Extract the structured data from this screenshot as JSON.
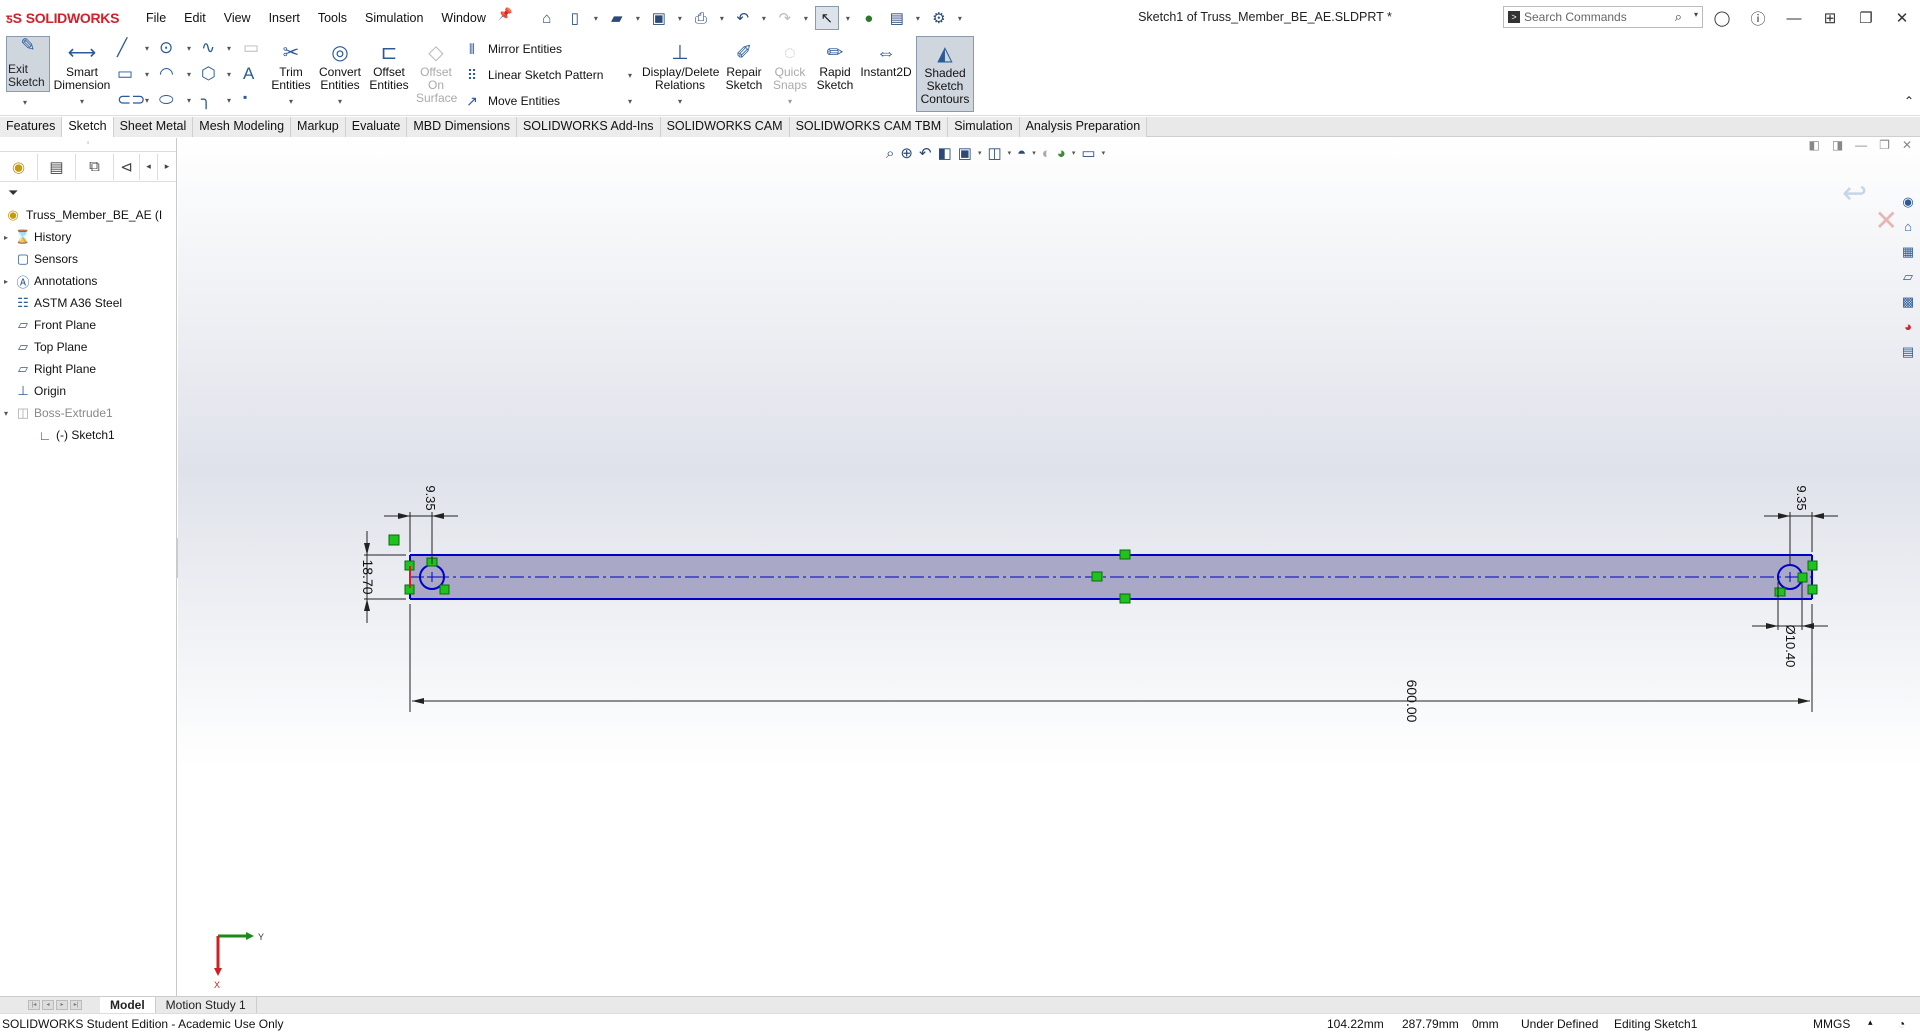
{
  "app": {
    "brand": "SOLIDWORKS",
    "document_title": "Sketch1 of Truss_Member_BE_AE.SLDPRT *",
    "menu": [
      "File",
      "Edit",
      "View",
      "Insert",
      "Tools",
      "Simulation",
      "Window"
    ],
    "search_placeholder": "Search Commands"
  },
  "ribbon": {
    "exit_sketch": "Exit Sketch",
    "smart_dimension": "Smart Dimension",
    "trim_entities": "Trim Entities",
    "convert_entities": "Convert Entities",
    "offset_entities": "Offset Entities",
    "offset_on_surface": "Offset On Surface",
    "mirror_entities": "Mirror Entities",
    "linear_sketch_pattern": "Linear Sketch Pattern",
    "move_entities": "Move Entities",
    "display_delete_relations": "Display/Delete Relations",
    "repair_sketch": "Repair Sketch",
    "quick_snaps": "Quick Snaps",
    "rapid_sketch": "Rapid Sketch",
    "instant2d": "Instant2D",
    "shaded_sketch_contours": "Shaded Sketch Contours"
  },
  "tabs": [
    "Features",
    "Sketch",
    "Sheet Metal",
    "Mesh Modeling",
    "Markup",
    "Evaluate",
    "MBD Dimensions",
    "SOLIDWORKS Add-Ins",
    "SOLIDWORKS CAM",
    "SOLIDWORKS CAM TBM",
    "Simulation",
    "Analysis Preparation"
  ],
  "active_tab": "Sketch",
  "tree": {
    "root": "Truss_Member_BE_AE (I",
    "items": [
      {
        "label": "History",
        "icon": "history-icon",
        "expandable": true
      },
      {
        "label": "Sensors",
        "icon": "sensors-icon",
        "expandable": false
      },
      {
        "label": "Annotations",
        "icon": "annotations-icon",
        "expandable": true
      },
      {
        "label": "ASTM A36 Steel",
        "icon": "material-icon",
        "expandable": false
      },
      {
        "label": "Front Plane",
        "icon": "plane-icon",
        "expandable": false
      },
      {
        "label": "Top Plane",
        "icon": "plane-icon",
        "expandable": false
      },
      {
        "label": "Right Plane",
        "icon": "plane-icon",
        "expandable": false
      },
      {
        "label": "Origin",
        "icon": "origin-icon",
        "expandable": false
      },
      {
        "label": "Boss-Extrude1",
        "icon": "extrude-icon",
        "expanded": true
      },
      {
        "label": "(-) Sketch1",
        "icon": "sketch-icon",
        "child": true
      }
    ]
  },
  "sketch": {
    "dim_length": "600.00",
    "dim_height": "18.70",
    "dim_left_offset": "9.35",
    "dim_right_offset": "9.35",
    "dim_hole_diameter": "Ø10.40"
  },
  "triad": {
    "y_label": "Y",
    "x_label": "X"
  },
  "bottom_tabs": [
    "Model",
    "Motion Study 1"
  ],
  "status": {
    "edition": "SOLIDWORKS Student Edition - Academic Use Only",
    "x": "104.22mm",
    "y": "287.79mm",
    "z": "0mm",
    "state": "Under Defined",
    "mode": "Editing Sketch1",
    "units": "MMGS"
  },
  "colors": {
    "brand_red": "#d4202a",
    "sketch_blue": "#0000cc",
    "shaded_fill": "#a9a9c7",
    "relation_green": "#1ec31e"
  }
}
